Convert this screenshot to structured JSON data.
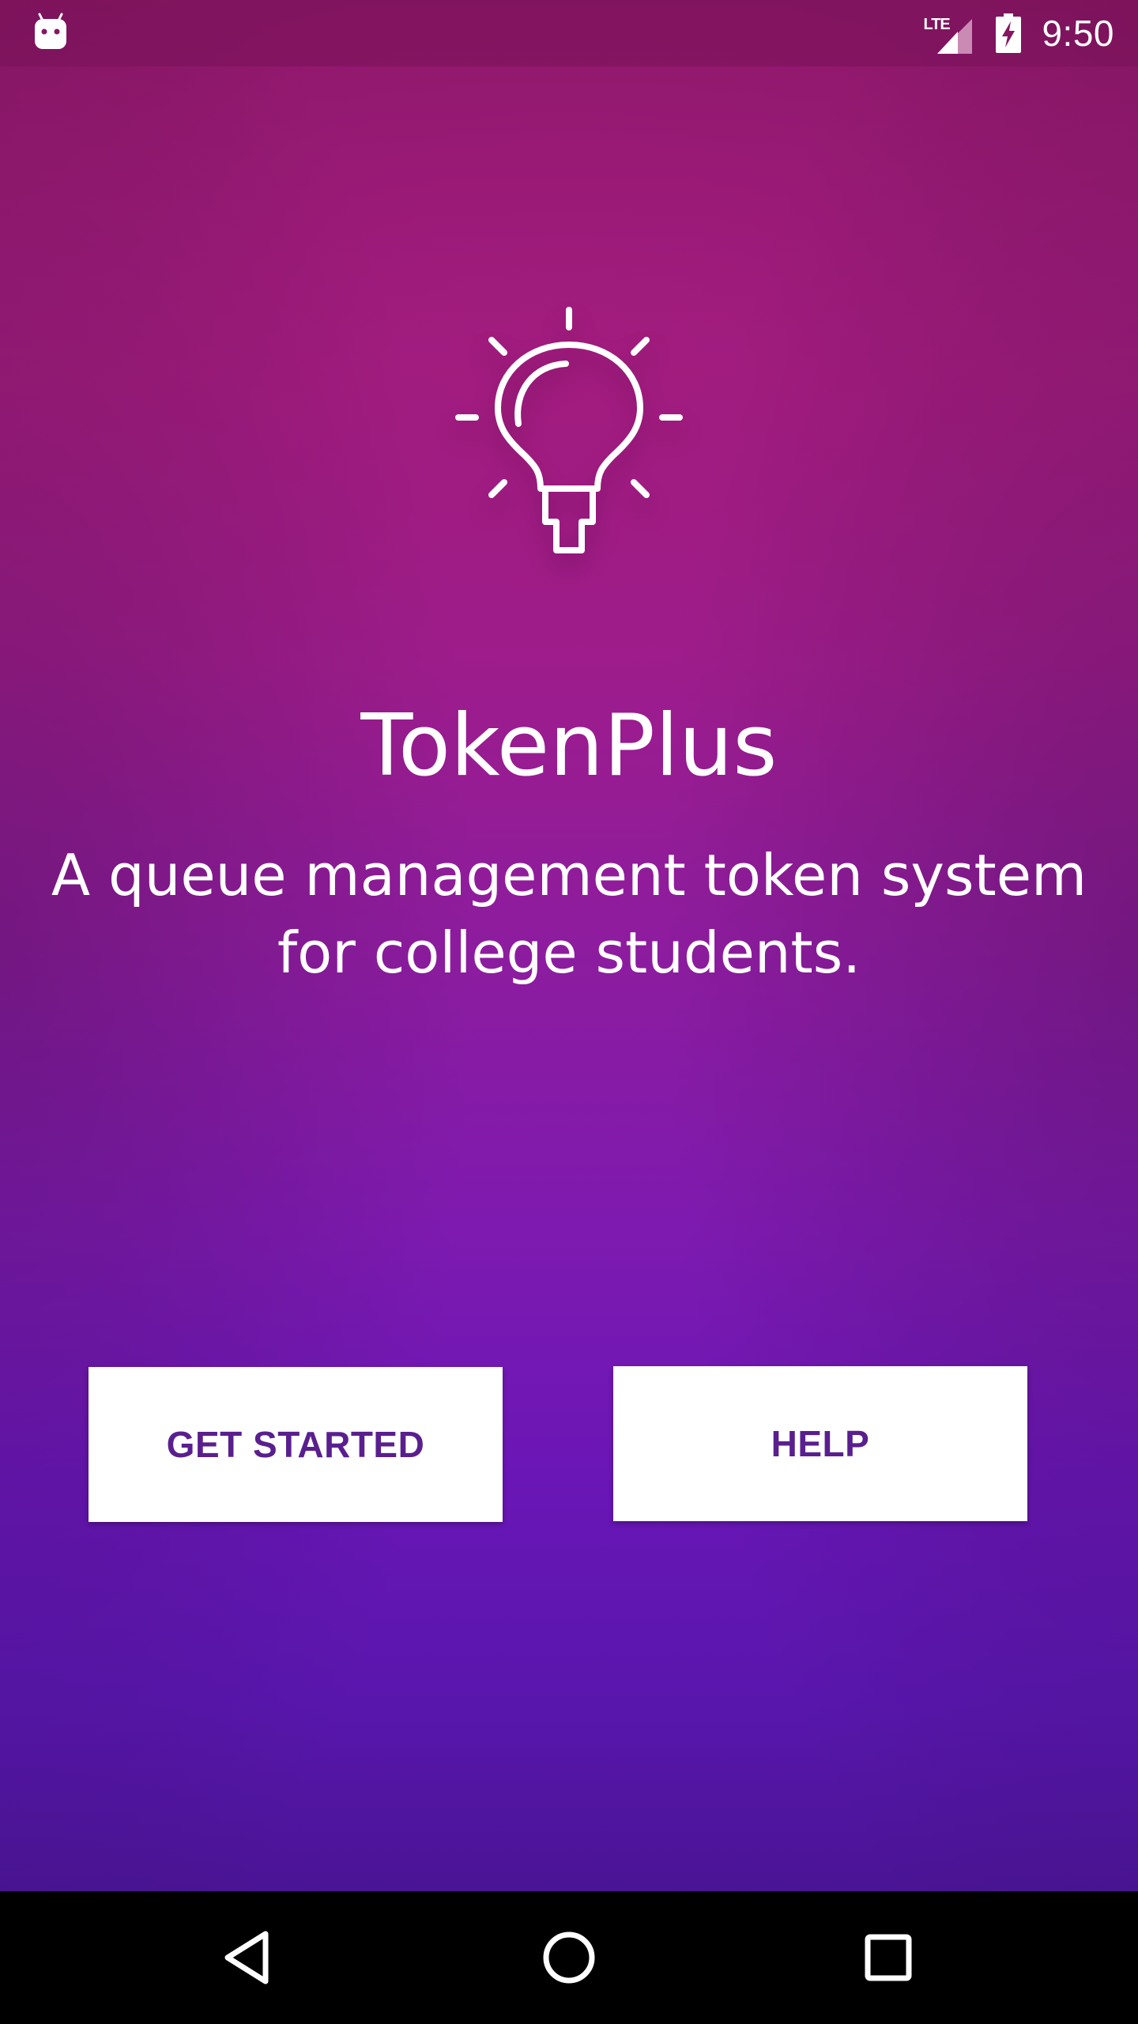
{
  "status_bar": {
    "network_label": "LTE",
    "time": "9:50",
    "left_icon": "android-notification-icon",
    "signal_icon": "cell-signal-icon",
    "battery_icon": "battery-charging-icon"
  },
  "hero": {
    "icon": "lightbulb-icon",
    "app_title": "TokenPlus",
    "subtitle_line1": "A queue management token system",
    "subtitle_line2": "for college students."
  },
  "actions": {
    "get_started_label": "GET STARTED",
    "help_label": "HELP"
  },
  "nav_bar": {
    "back_icon": "back-triangle-icon",
    "home_icon": "home-circle-icon",
    "recents_icon": "recents-square-icon"
  },
  "colors": {
    "gradient_top": "#861663",
    "gradient_mid": "#9a1c8e",
    "gradient_bottom": "#4a1495",
    "button_background": "#ffffff",
    "button_text": "#5a1f8e"
  }
}
